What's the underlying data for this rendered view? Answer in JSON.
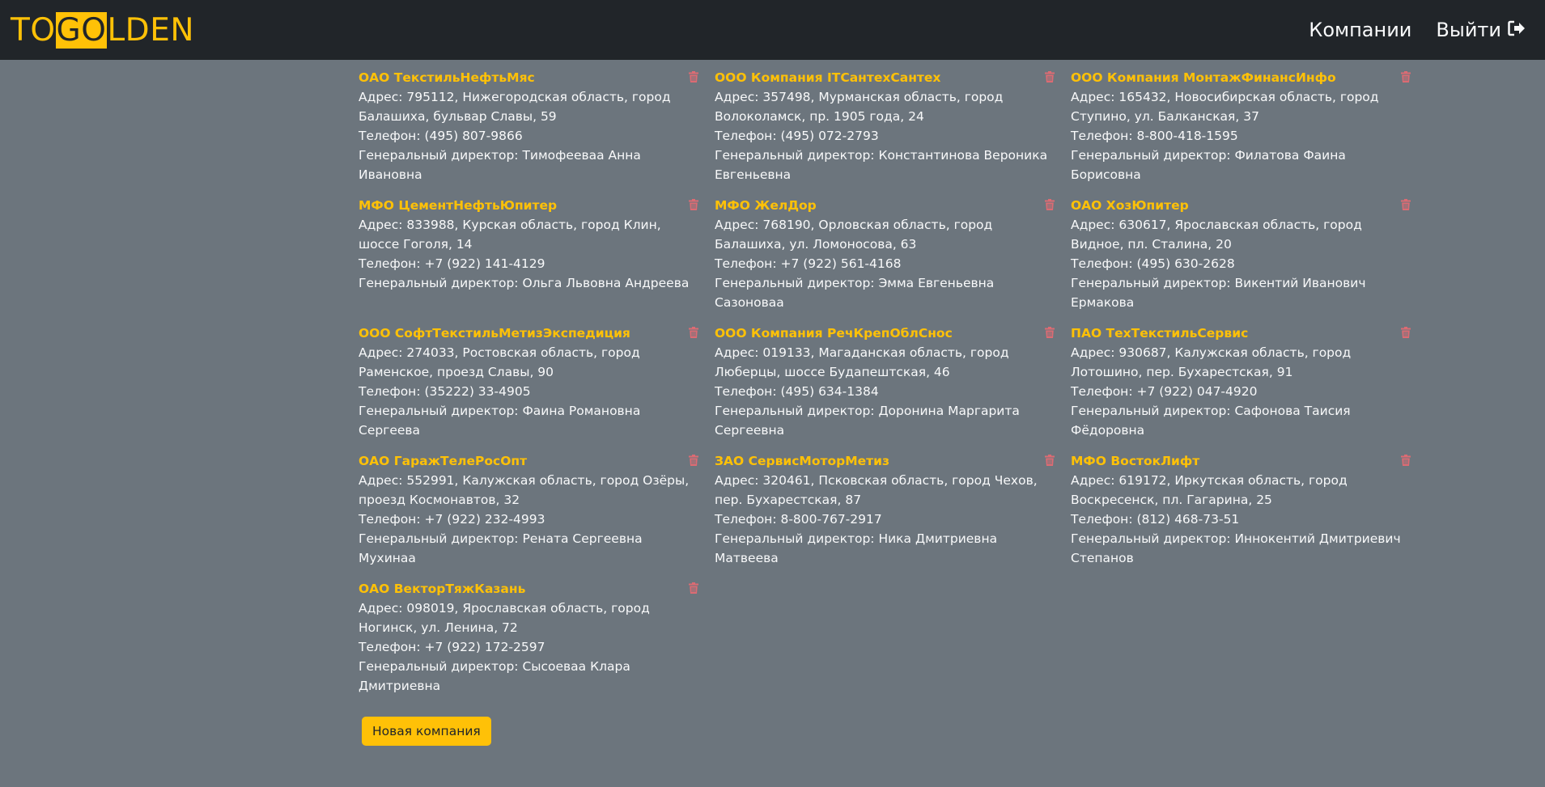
{
  "navbar": {
    "brand_parts": [
      "TO",
      "GO",
      "LDEN"
    ],
    "companies_link": "Компании",
    "logout_link": "Выйти"
  },
  "companies": [
    {
      "name": "ОАО ТекстильНефтьМяс",
      "address": "Адрес: 795112, Нижегородская область, город Балашиха, бульвар Славы, 59",
      "phone": "Телефон: (495) 807-9866",
      "director": "Генеральный директор: Тимофееваа Анна Ивановна"
    },
    {
      "name": "ООО Компания ITСантехСантех",
      "address": "Адрес: 357498, Мурманская область, город Волоколамск, пр. 1905 года, 24",
      "phone": "Телефон: (495) 072-2793",
      "director": "Генеральный директор: Константинова Вероника Евгеньевна"
    },
    {
      "name": "ООО Компания МонтажФинансИнфо",
      "address": "Адрес: 165432, Новосибирская область, город Ступино, ул. Балканская, 37",
      "phone": "Телефон: 8-800-418-1595",
      "director": "Генеральный директор: Филатова Фаина Борисовна"
    },
    {
      "name": "МФО ЦементНефтьЮпитер",
      "address": "Адрес: 833988, Курская область, город Клин, шоссе Гоголя, 14",
      "phone": "Телефон: +7 (922) 141-4129",
      "director": "Генеральный директор: Ольга Львовна Андреева"
    },
    {
      "name": "МФО ЖелДор",
      "address": "Адрес: 768190, Орловская область, город Балашиха, ул. Ломоносова, 63",
      "phone": "Телефон: +7 (922) 561-4168",
      "director": "Генеральный директор: Эмма Евгеньевна Сазоноваа"
    },
    {
      "name": "ОАО ХозЮпитер",
      "address": "Адрес: 630617, Ярославская область, город Видное, пл. Сталина, 20",
      "phone": "Телефон: (495) 630-2628",
      "director": "Генеральный директор: Викентий Иванович Ермакова"
    },
    {
      "name": "ООО СофтТекстильМетизЭкспедиция",
      "address": "Адрес: 274033, Ростовская область, город Раменское, проезд Славы, 90",
      "phone": "Телефон: (35222) 33-4905",
      "director": "Генеральный директор: Фаина Романовна Сергеева"
    },
    {
      "name": "ООО Компания РечКрепОблСнос",
      "address": "Адрес: 019133, Магаданская область, город Люберцы, шоссе Будапештская, 46",
      "phone": "Телефон: (495) 634-1384",
      "director": "Генеральный директор: Доронина Маргарита Сергеевна"
    },
    {
      "name": "ПАО ТехТекстильСервис",
      "address": "Адрес: 930687, Калужская область, город Лотошино, пер. Бухарестская, 91",
      "phone": "Телефон: +7 (922) 047-4920",
      "director": "Генеральный директор: Сафонова Таисия Фёдоровна"
    },
    {
      "name": "ОАО ГаражТелеРосОпт",
      "address": "Адрес: 552991, Калужская область, город Озёры, проезд Космонавтов, 32",
      "phone": "Телефон: +7 (922) 232-4993",
      "director": "Генеральный директор: Рената Сергеевна Мухинаа"
    },
    {
      "name": "ЗАО СервисМоторМетиз",
      "address": "Адрес: 320461, Псковская область, город Чехов, пер. Бухарестская, 87",
      "phone": "Телефон: 8-800-767-2917",
      "director": "Генеральный директор: Ника Дмитриевна Матвеева"
    },
    {
      "name": "МФО ВостокЛифт",
      "address": "Адрес: 619172, Иркутская область, город Воскресенск, пл. Гагарина, 25",
      "phone": "Телефон: (812) 468-73-51",
      "director": "Генеральный директор: Иннокентий Дмитриевич Степанов"
    },
    {
      "name": "ОАО ВекторТяжКазань",
      "address": "Адрес: 098019, Ярославская область, город Ногинск, ул. Ленина, 72",
      "phone": "Телефон: +7 (922) 172-2597",
      "director": "Генеральный директор: Сысоеваа Клара Дмитриевна"
    }
  ],
  "new_company_button": "Новая компания",
  "colors": {
    "accent": "#ffc107",
    "navbar": "#212529",
    "background": "#6c757d",
    "trash": "#dc6b73"
  }
}
